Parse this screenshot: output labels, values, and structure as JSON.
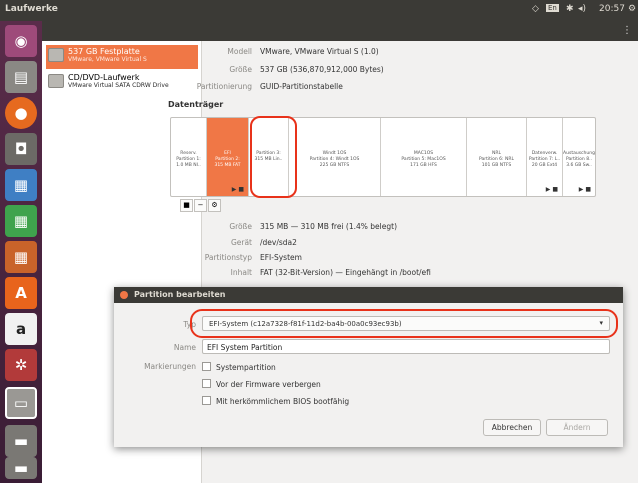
{
  "topbar": {
    "title": "Laufwerke",
    "time": "20:57"
  },
  "devices": [
    {
      "name": "537 GB Festplatte",
      "sub": "VMware, VMware Virtual S"
    },
    {
      "name": "CD/DVD-Laufwerk",
      "sub": "VMware Virtual SATA CDRW Drive"
    }
  ],
  "disk_info": [
    {
      "key": "Modell",
      "value": "VMware, VMware Virtual S (1.0)"
    },
    {
      "key": "Größe",
      "value": "537 GB (536,870,912,000 Bytes)"
    },
    {
      "key": "Partitionierung",
      "value": "GUID-Partitionstabelle"
    }
  ],
  "volumes_label": "Datenträger",
  "partitions": [
    {
      "l1": "Reserv.",
      "l2": "Partition 1:",
      "l3": "1.0 MB NI.."
    },
    {
      "l1": "EFI",
      "l2": "Partition 2:",
      "l3": "315 MB FAT"
    },
    {
      "l1": "Partition 3:",
      "l2": "315 MB Lin..",
      "l3": ""
    },
    {
      "l1": "Windt 1OS",
      "l2": "Partition 4: Windt 1OS",
      "l3": "225 GB NTFS"
    },
    {
      "l1": "MAC1OS",
      "l2": "Partition 5: Mac1OS",
      "l3": "171 GB HFS"
    },
    {
      "l1": "NRL",
      "l2": "Partition 6: NRL",
      "l3": "101 GB NTFS"
    },
    {
      "l1": "Datenverw.",
      "l2": "Partition 7: L..",
      "l3": "20 GB Ext4"
    },
    {
      "l1": "Austauschung",
      "l2": "Partition 8..",
      "l3": "3.6 GB Sw.."
    }
  ],
  "selected_info": [
    {
      "key": "Größe",
      "value": "315 MB — 310 MB frei (1.4% belegt)"
    },
    {
      "key": "Gerät",
      "value": "/dev/sda2"
    },
    {
      "key": "Partitionstyp",
      "value": "EFI-System"
    },
    {
      "key": "Inhalt",
      "value": "FAT (32-Bit-Version) — Eingehängt in /boot/efi"
    }
  ],
  "dialog": {
    "title": "Partition bearbeiten",
    "type_label": "Typ",
    "type_value": "EFI-System (c12a7328-f81f-11d2-ba4b-00a0c93ec93b)",
    "name_label": "Name",
    "name_value": "EFI System Partition",
    "flags_label": "Markierungen",
    "flags": [
      "Systempartition",
      "Vor der Firmware verbergen",
      "Mit herkömmlichem BIOS bootfähig"
    ],
    "cancel": "Abbrechen",
    "ok": "Ändern"
  }
}
